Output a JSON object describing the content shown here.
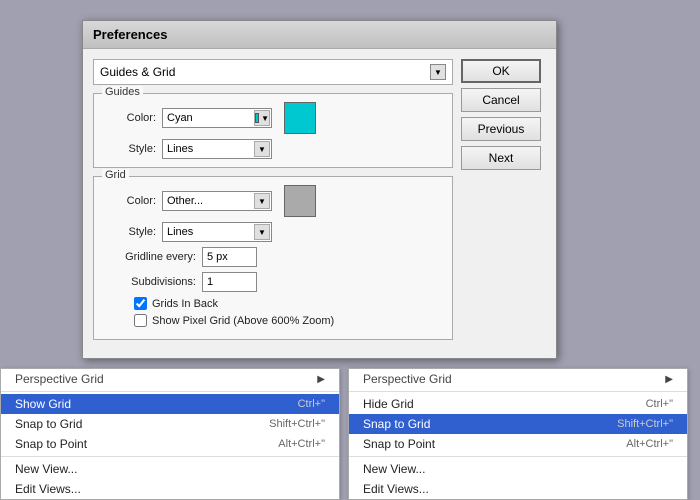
{
  "dialog": {
    "title": "Preferences",
    "section_label": "Guides & Grid",
    "guides_group_label": "Guides",
    "grid_group_label": "Grid",
    "guides": {
      "color_label": "Color:",
      "color_value": "Cyan",
      "style_label": "Style:",
      "style_value": "Lines"
    },
    "grid": {
      "color_label": "Color:",
      "color_value": "Other...",
      "style_label": "Style:",
      "style_value": "Lines",
      "gridline_label": "Gridline every:",
      "gridline_value": "5 px",
      "subdivisions_label": "Subdivisions:",
      "subdivisions_value": "1",
      "grids_in_back_label": "Grids In Back",
      "grids_in_back_checked": true,
      "show_pixel_label": "Show Pixel Grid (Above 600% Zoom)",
      "show_pixel_checked": false
    },
    "buttons": {
      "ok": "OK",
      "cancel": "Cancel",
      "previous": "Previous",
      "next": "Next"
    }
  },
  "left_menu": {
    "header": "Perspective Grid",
    "items": [
      {
        "label": "Show Grid",
        "shortcut": "Ctrl+\"",
        "highlighted": true
      },
      {
        "label": "Snap to Grid",
        "shortcut": "Shift+Ctrl+\"",
        "highlighted": false
      },
      {
        "label": "Snap to Point",
        "shortcut": "Alt+Ctrl+\"",
        "highlighted": false
      },
      {
        "label": "New View...",
        "shortcut": "",
        "highlighted": false
      },
      {
        "label": "Edit Views...",
        "shortcut": "",
        "highlighted": false
      }
    ]
  },
  "right_menu": {
    "header": "Perspective Grid",
    "items": [
      {
        "label": "Hide Grid",
        "shortcut": "Ctrl+\"",
        "highlighted": false
      },
      {
        "label": "Snap to Grid",
        "shortcut": "Shift+Ctrl+\"",
        "highlighted": true
      },
      {
        "label": "Snap to Point",
        "shortcut": "Alt+Ctrl+\"",
        "highlighted": false
      },
      {
        "label": "New View...",
        "shortcut": "",
        "highlighted": false
      },
      {
        "label": "Edit Views...",
        "shortcut": "",
        "highlighted": false
      }
    ]
  }
}
